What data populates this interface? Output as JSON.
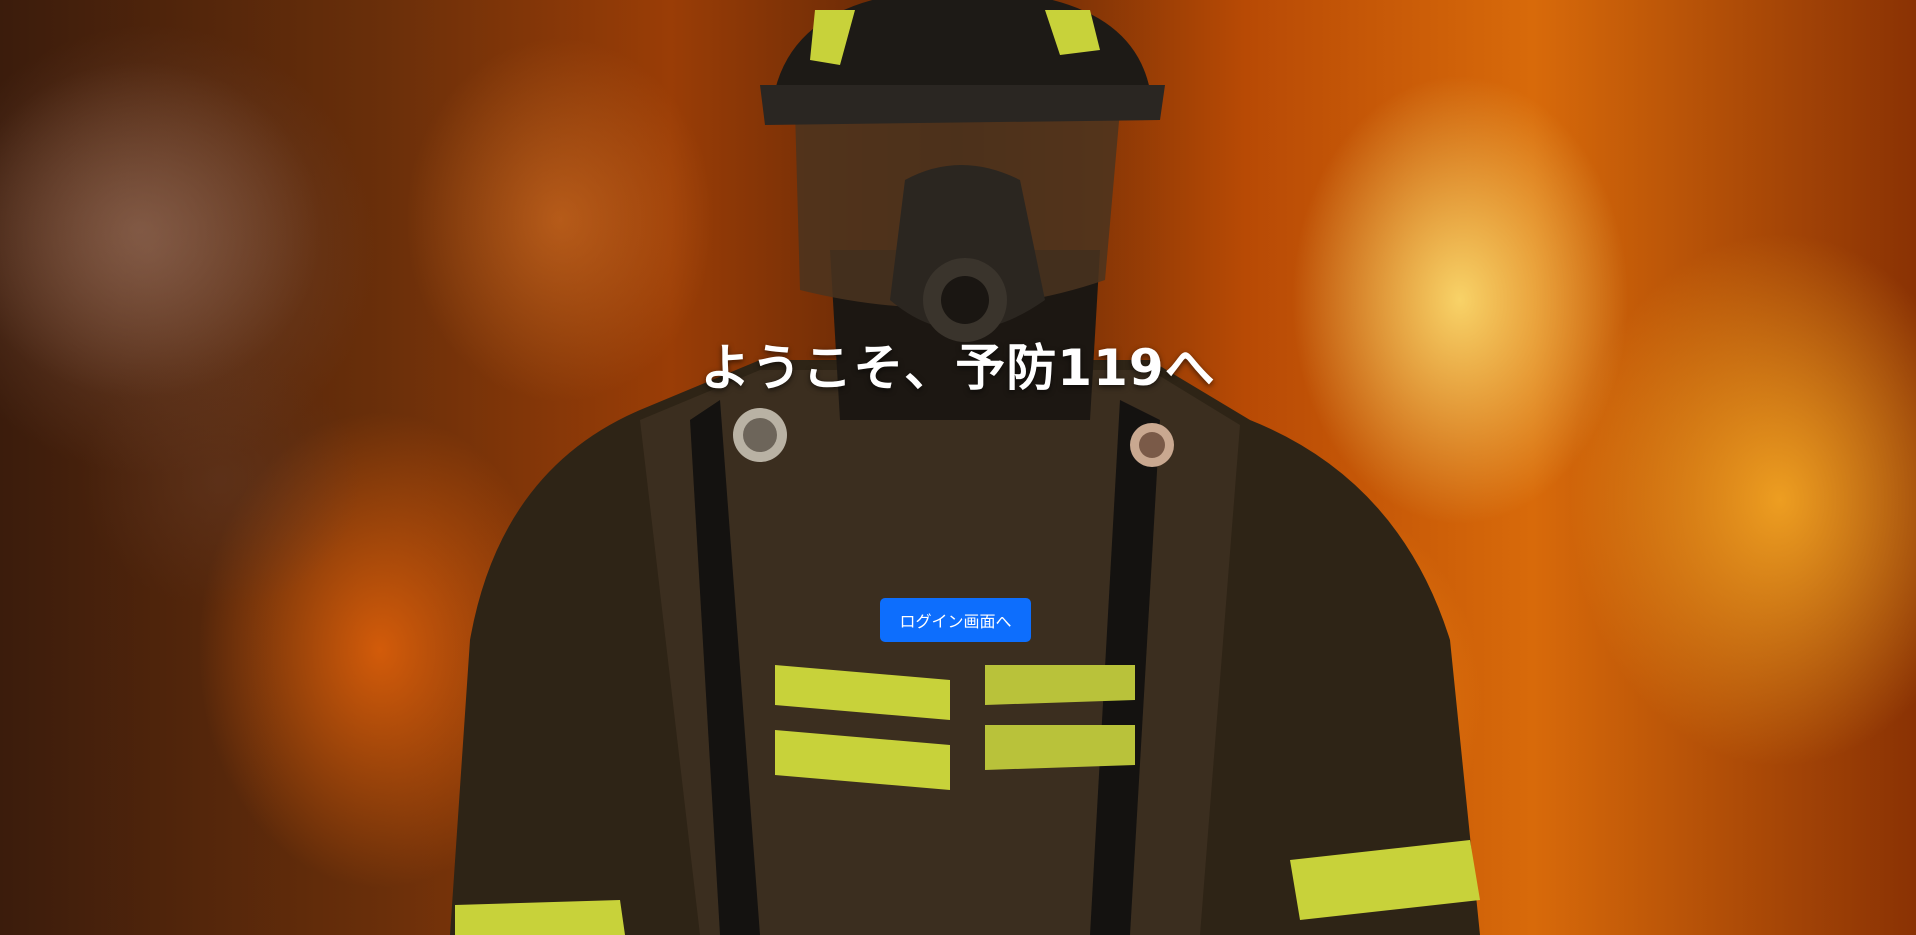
{
  "hero": {
    "title": "ようこそ、予防119へ",
    "background_image": "firefighter-in-flames"
  },
  "login_button": {
    "label": "ログイン画面へ",
    "color": "#0d6efd"
  }
}
